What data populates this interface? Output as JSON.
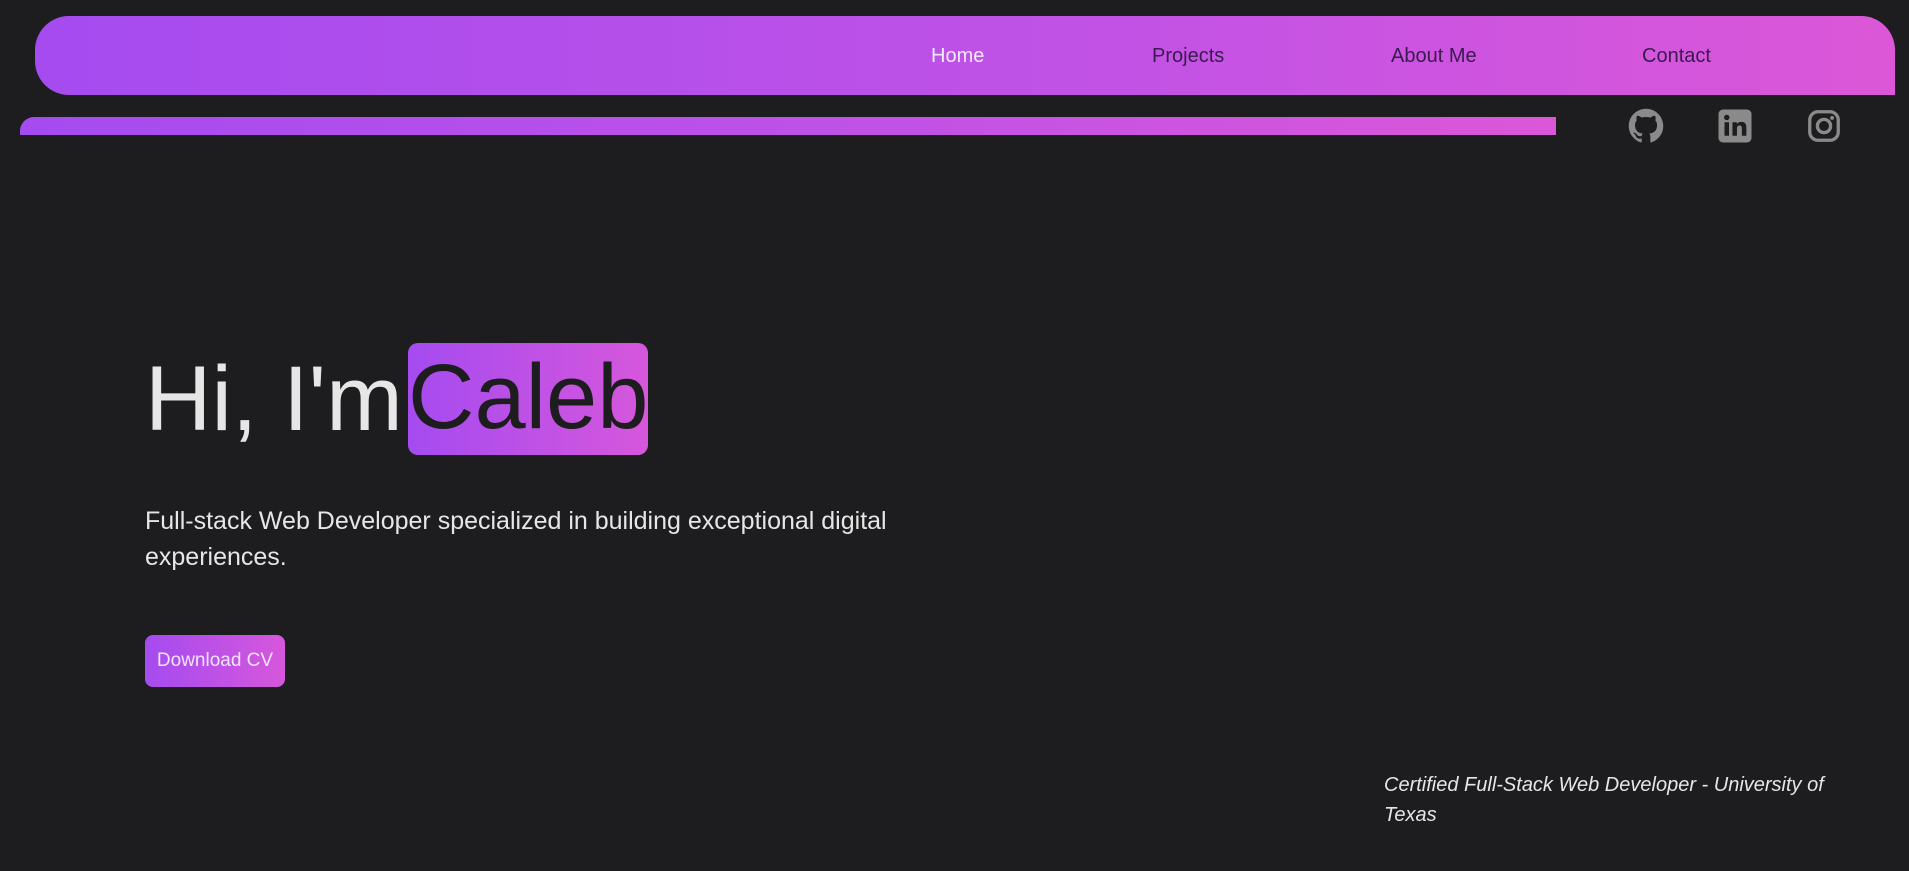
{
  "nav": {
    "links": [
      {
        "label": "Home",
        "active": true
      },
      {
        "label": "Projects",
        "active": false
      },
      {
        "label": "About Me",
        "active": false
      },
      {
        "label": "Contact",
        "active": false
      }
    ]
  },
  "social": {
    "icons": [
      "github-icon",
      "linkedin-icon",
      "instagram-icon"
    ]
  },
  "hero": {
    "greeting": "Hi, I'm",
    "name": "Caleb",
    "subtitle": "Full-stack Web Developer specialized in building exceptional digital experiences."
  },
  "cta": {
    "download_cv_label": "Download CV"
  },
  "certification": {
    "text": "Certified Full-Stack Web Developer - University of Texas"
  },
  "colors": {
    "background": "#1d1d1f",
    "gradient_start": "#a54bf0",
    "gradient_end": "#db57d8",
    "text": "#e6e6e6",
    "nav_text": "#3a1a4f",
    "icon": "#8a8a8a"
  }
}
